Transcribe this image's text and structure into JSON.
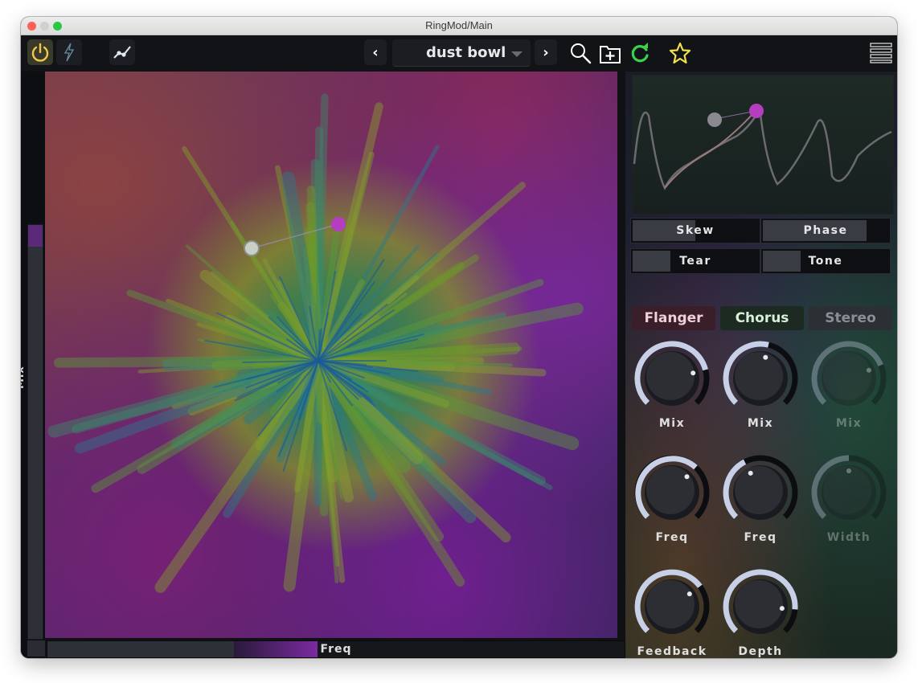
{
  "window": {
    "title": "RingMod/Main"
  },
  "toolbar": {
    "preset_name": "dust bowl",
    "prev_label": "‹",
    "next_label": "›",
    "colors": {
      "power": "#f2c84b",
      "accent_green": "#3ad24a",
      "star": "#f2e24a"
    }
  },
  "xy_pad": {
    "y_label": "Mix",
    "x_label": "Freq",
    "mix_value": 0.96,
    "freq_value_start": 0.33,
    "freq_value_end": 0.47
  },
  "distort": {
    "buttons": [
      {
        "label": "Skew",
        "fill": 0.5
      },
      {
        "label": "Phase",
        "fill": 0.83
      },
      {
        "label": "Tear",
        "fill": 0.3
      },
      {
        "label": "Tone",
        "fill": 0.3
      }
    ]
  },
  "effects": {
    "tabs": [
      {
        "label": "Flanger",
        "color": "#f0d0d8",
        "bg": "#3a1e2a"
      },
      {
        "label": "Chorus",
        "color": "#d6f0d8",
        "bg": "#1c2a22"
      },
      {
        "label": "Stereo",
        "color": "#8a8f96",
        "bg": "#2c2f34"
      }
    ],
    "knobs": [
      {
        "label": "Mix",
        "value": 0.78
      },
      {
        "label": "Mix",
        "value": 0.55
      },
      {
        "label": "Mix",
        "value": 0.75,
        "disabled": true
      },
      {
        "label": "Freq",
        "value": 0.66
      },
      {
        "label": "Freq",
        "value": 0.4
      },
      {
        "label": "Width",
        "value": 0.5,
        "disabled": true
      },
      {
        "label": "Feedback",
        "value": 0.7
      },
      {
        "label": "Depth",
        "value": 0.85
      }
    ]
  }
}
